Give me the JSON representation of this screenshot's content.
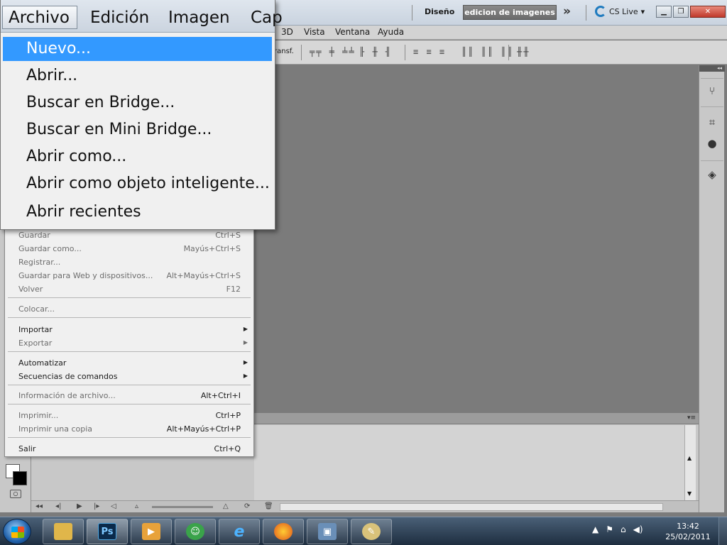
{
  "app": {
    "workspace_label": "Diseño",
    "workspace_button": "edicion de imagenes",
    "cs_live": "CS Live",
    "more_icon": "double-chevron-right-icon"
  },
  "menubar": {
    "zoomed_items": [
      "Archivo",
      "Edición",
      "Imagen",
      "Cap"
    ],
    "rest_items": [
      "3D",
      "Vista",
      "Ventana",
      "Ayuda"
    ]
  },
  "options_bar": {
    "transform_label": "ransf."
  },
  "zoom_menu": {
    "items": [
      "Nuevo...",
      "Abrir...",
      "Buscar en Bridge...",
      "Buscar en Mini Bridge...",
      "Abrir como...",
      "Abrir como objeto inteligente...",
      "Abrir recientes"
    ],
    "highlighted": "Nuevo..."
  },
  "file_menu": {
    "group1": [
      {
        "label": "Guardar",
        "shortcut": "Ctrl+S",
        "enabled": false
      },
      {
        "label": "Guardar como...",
        "shortcut": "Mayús+Ctrl+S",
        "enabled": false
      },
      {
        "label": "Registrar...",
        "shortcut": "",
        "enabled": false
      },
      {
        "label": "Guardar para Web y dispositivos...",
        "shortcut": "Alt+Mayús+Ctrl+S",
        "enabled": false
      },
      {
        "label": "Volver",
        "shortcut": "F12",
        "enabled": false
      }
    ],
    "group2": [
      {
        "label": "Colocar...",
        "enabled": false
      }
    ],
    "group3": [
      {
        "label": "Importar",
        "submenu": true,
        "enabled": true
      },
      {
        "label": "Exportar",
        "submenu": true,
        "enabled": false
      }
    ],
    "group4": [
      {
        "label": "Automatizar",
        "submenu": true,
        "enabled": true
      },
      {
        "label": "Secuencias de comandos",
        "submenu": true,
        "enabled": true
      }
    ],
    "group5": [
      {
        "label": "Información de archivo...",
        "shortcut": "Alt+Ctrl+I",
        "enabled": false
      }
    ],
    "group6": [
      {
        "label": "Imprimir...",
        "shortcut": "Ctrl+P",
        "enabled": false
      },
      {
        "label": "Imprimir una copia",
        "shortcut": "Alt+Mayús+Ctrl+P",
        "enabled": false
      }
    ],
    "group7": [
      {
        "label": "Salir",
        "shortcut": "Ctrl+Q",
        "enabled": true
      }
    ]
  },
  "taskbar": {
    "apps": [
      "windows-explorer",
      "photoshop",
      "media-player",
      "messenger",
      "internet-explorer",
      "firefox",
      "network",
      "paint"
    ],
    "ps_label": "Ps",
    "time": "13:42",
    "date": "25/02/2011"
  },
  "colors": {
    "highlight": "#3399ff",
    "workspace_bg": "#7b7b7b"
  }
}
